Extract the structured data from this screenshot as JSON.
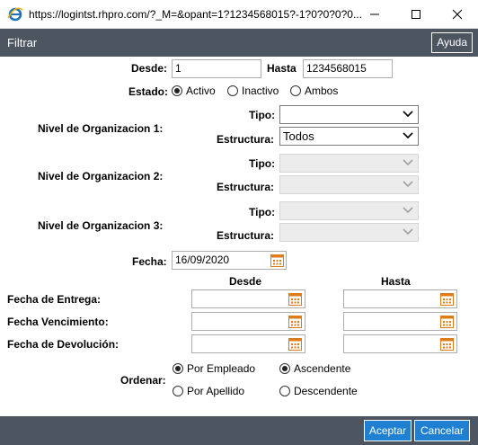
{
  "window": {
    "url": "https://logintst.rhpro.com/?_M=&opant=1?1234568015?-1?0?0?0?0..."
  },
  "header": {
    "title": "Filtrar",
    "help_label": "Ayuda"
  },
  "form": {
    "desde_label": "Desde:",
    "desde_value": "1",
    "hasta_label": "Hasta",
    "hasta_value": "1234568015",
    "estado_label": "Estado:",
    "estado_options": [
      "Activo",
      "Inactivo",
      "Ambos"
    ],
    "estado_selected": "Activo",
    "niveles": [
      {
        "label": "Nivel de Organizacion 1:",
        "tipo_label": "Tipo:",
        "tipo_value": "",
        "estructura_label": "Estructura:",
        "estructura_value": "Todos",
        "enabled": true
      },
      {
        "label": "Nivel de Organizacion 2:",
        "tipo_label": "Tipo:",
        "tipo_value": "",
        "estructura_label": "Estructura:",
        "estructura_value": "",
        "enabled": false
      },
      {
        "label": "Nivel de Organizacion 3:",
        "tipo_label": "Tipo:",
        "tipo_value": "",
        "estructura_label": "Estructura:",
        "estructura_value": "",
        "enabled": false
      }
    ],
    "fecha_label": "Fecha:",
    "fecha_value": "16/09/2020",
    "col_desde": "Desde",
    "col_hasta": "Hasta",
    "date_rows": [
      {
        "label": "Fecha de Entrega:",
        "desde": "",
        "hasta": ""
      },
      {
        "label": "Fecha Vencimiento:",
        "desde": "",
        "hasta": ""
      },
      {
        "label": "Fecha de Devolución:",
        "desde": "",
        "hasta": ""
      }
    ],
    "ordenar_label": "Ordenar:",
    "order_by_options": [
      "Por Empleado",
      "Por Apellido"
    ],
    "order_by_selected": "Por Empleado",
    "direction_options": [
      "Ascendente",
      "Descendente"
    ],
    "direction_selected": "Ascendente"
  },
  "footer": {
    "accept_label": "Aceptar",
    "cancel_label": "Cancelar"
  },
  "colors": {
    "header_bg": "#4d5561",
    "button_bg": "#1f7fd0",
    "calendar_icon": "#e07b1a"
  }
}
